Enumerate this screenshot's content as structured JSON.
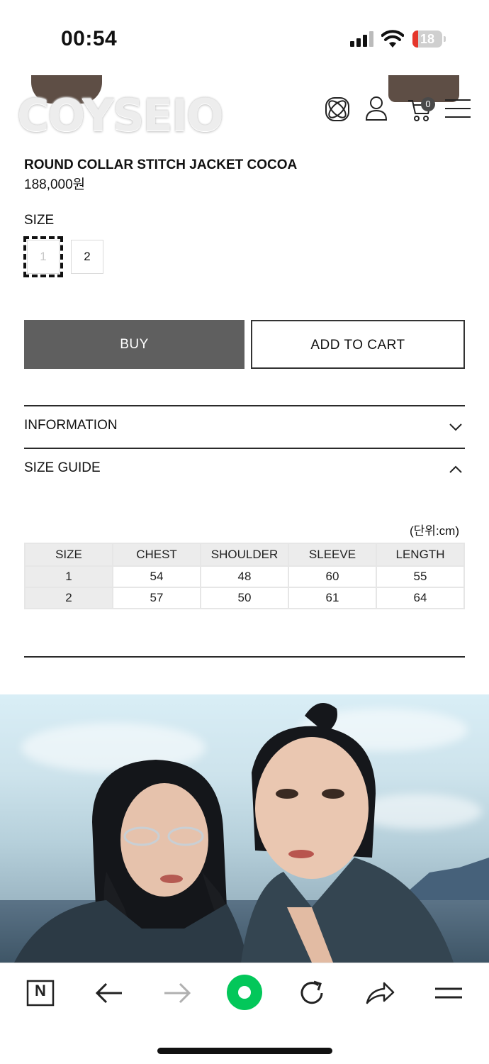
{
  "status": {
    "time": "00:54",
    "battery": "18",
    "battery_level": 0.18
  },
  "header": {
    "logo": "COYSEIO",
    "cart_count": "0"
  },
  "product": {
    "title": "ROUND COLLAR STITCH JACKET COCOA",
    "price": "188,000원",
    "size_label": "SIZE",
    "sizes": [
      "1",
      "2"
    ]
  },
  "actions": {
    "buy": "BUY",
    "add_to_cart": "ADD TO CART"
  },
  "accordion": {
    "information": "INFORMATION",
    "size_guide": "SIZE GUIDE"
  },
  "size_guide": {
    "unit": "(단위:cm)",
    "headers": [
      "SIZE",
      "CHEST",
      "SHOULDER",
      "SLEEVE",
      "LENGTH"
    ],
    "rows": [
      [
        "1",
        "54",
        "48",
        "60",
        "55"
      ],
      [
        "2",
        "57",
        "50",
        "61",
        "64"
      ]
    ]
  },
  "toolbar": {
    "naver_label": "N"
  },
  "colors": {
    "buy_bg": "#5f5f5f",
    "naver_green": "#03c75a",
    "battery_red": "#e5372c"
  }
}
